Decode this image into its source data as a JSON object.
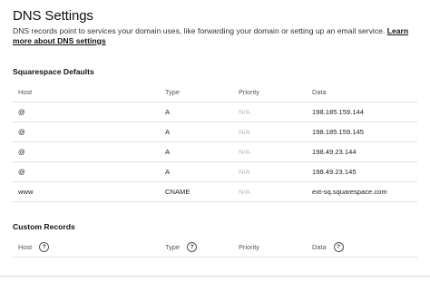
{
  "title": "DNS Settings",
  "description": {
    "text": "DNS records point to services your domain uses, like forwarding your domain or setting up an email service.",
    "link_label": "Learn more about DNS settings"
  },
  "defaults": {
    "section_title": "Squarespace Defaults",
    "columns": {
      "host": "Host",
      "type": "Type",
      "priority": "Priority",
      "data": "Data"
    },
    "rows": [
      {
        "host": "@",
        "type": "A",
        "priority": "N/A",
        "data": "198.185.159.144"
      },
      {
        "host": "@",
        "type": "A",
        "priority": "N/A",
        "data": "198.185.159.145"
      },
      {
        "host": "@",
        "type": "A",
        "priority": "N/A",
        "data": "198.49.23.144"
      },
      {
        "host": "@",
        "type": "A",
        "priority": "N/A",
        "data": "198.49.23.145"
      },
      {
        "host": "www",
        "type": "CNAME",
        "priority": "N/A",
        "data": "ext-sq.squarespace.com"
      }
    ]
  },
  "custom": {
    "section_title": "Custom Records",
    "columns": {
      "host": "Host",
      "type": "Type",
      "priority": "Priority",
      "data": "Data"
    },
    "help_icon": "?"
  }
}
